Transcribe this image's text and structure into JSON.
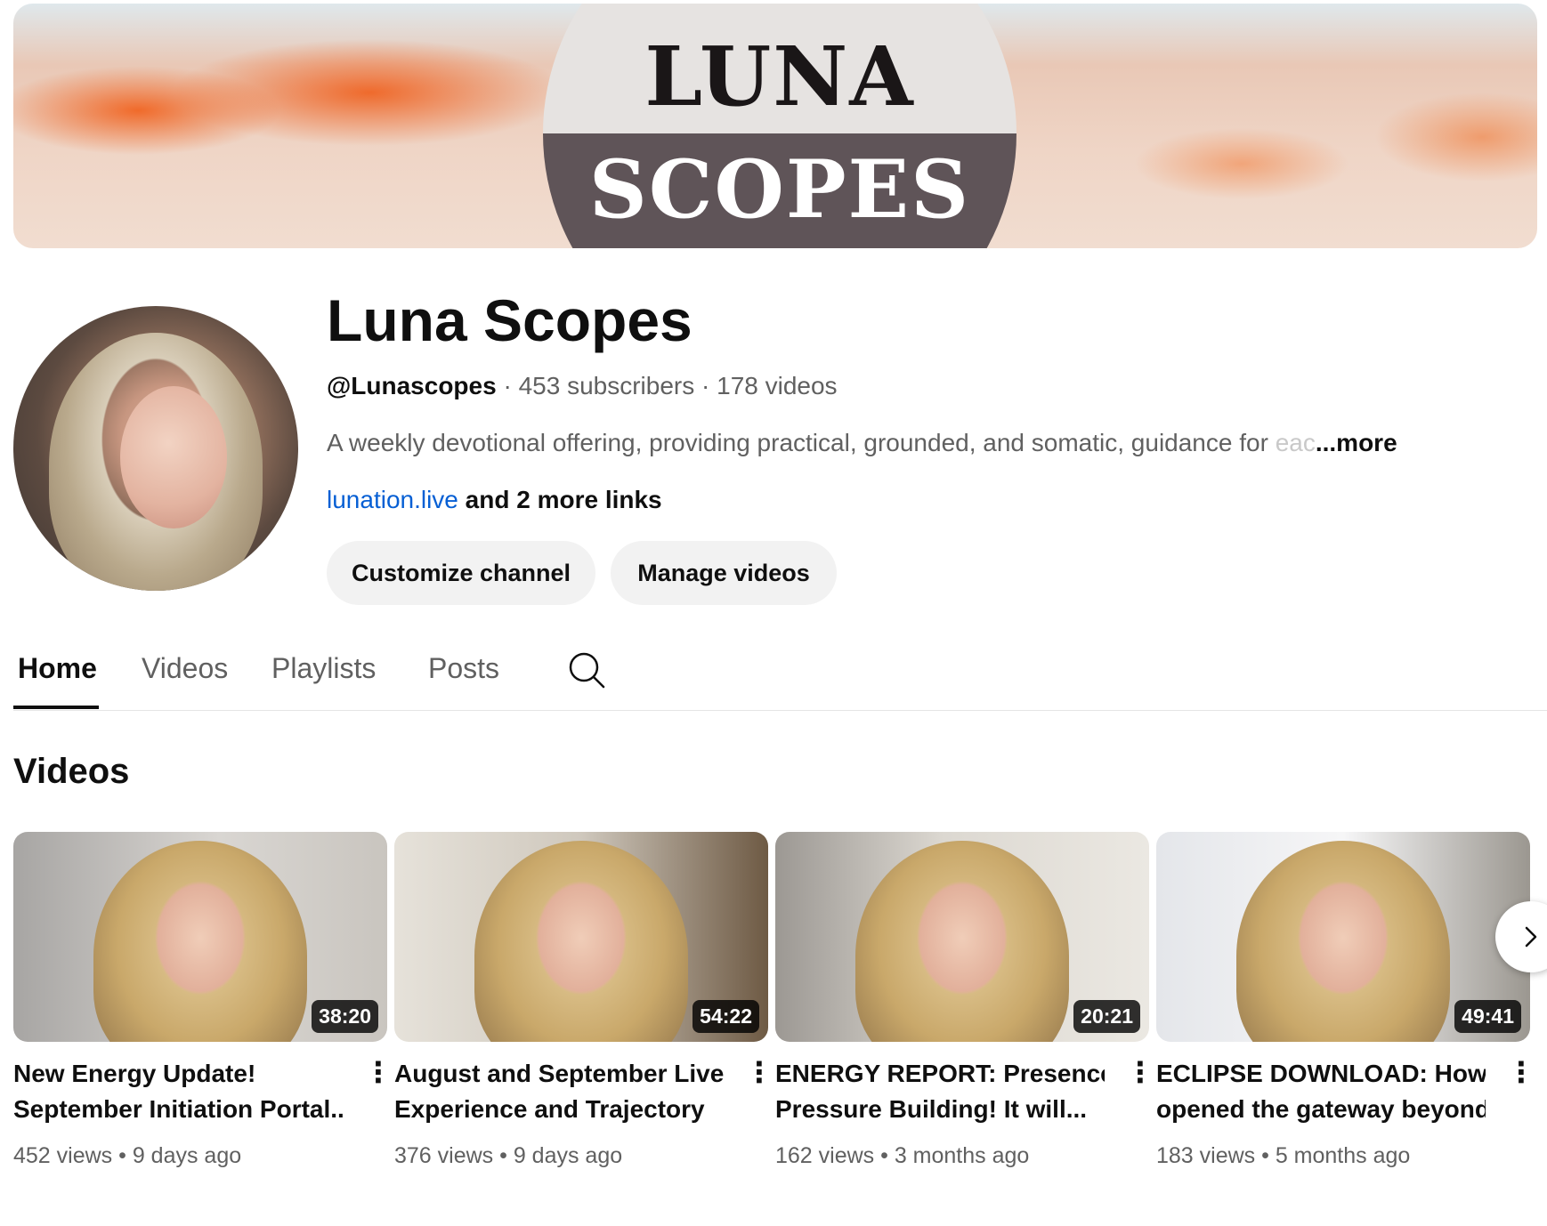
{
  "banner": {
    "logo_line1": "LUNA",
    "logo_line2": "SCOPES"
  },
  "channel": {
    "name": "Luna Scopes",
    "handle": "@Lunascopes",
    "subscribers": "453 subscribers",
    "videos_count": "178 videos",
    "meta_separator": " · ",
    "description": "A weekly devotional offering, providing practical, grounded, and somatic, guidance for ",
    "description_fade": "eac",
    "description_more": "...more",
    "link_text": "lunation.live",
    "more_links": " and 2 more links"
  },
  "buttons": {
    "customize": "Customize channel",
    "manage": "Manage videos"
  },
  "tabs": [
    {
      "label": "Home",
      "active": true
    },
    {
      "label": "Videos",
      "active": false
    },
    {
      "label": "Playlists",
      "active": false
    },
    {
      "label": "Posts",
      "active": false
    }
  ],
  "section": {
    "title": "Videos"
  },
  "videos": [
    {
      "title_line1": "New Energy Update!",
      "title_line2": "September Initiation Portal...",
      "duration": "38:20",
      "views": "452 views",
      "age": "9 days ago"
    },
    {
      "title_line1": "August and September Lived",
      "title_line2": "Experience and Trajectory",
      "duration": "54:22",
      "views": "376 views",
      "age": "9 days ago"
    },
    {
      "title_line1": "ENERGY REPORT: Presence",
      "title_line2": "Pressure Building! It will...",
      "duration": "20:21",
      "views": "162 views",
      "age": "3 months ago"
    },
    {
      "title_line1": "ECLIPSE DOWNLOAD: How I",
      "title_line2": "opened the gateway beyond...",
      "duration": "49:41",
      "views": "183 views",
      "age": "5 months ago"
    }
  ],
  "meta_dot": " • ",
  "icons": {
    "search": "search-icon",
    "more": "more-vert-icon",
    "next": "chevron-right-icon"
  },
  "colors": {
    "link": "#065fd4",
    "banner_logo_bottom": "#5f5458",
    "button_bg": "#f2f2f2"
  }
}
